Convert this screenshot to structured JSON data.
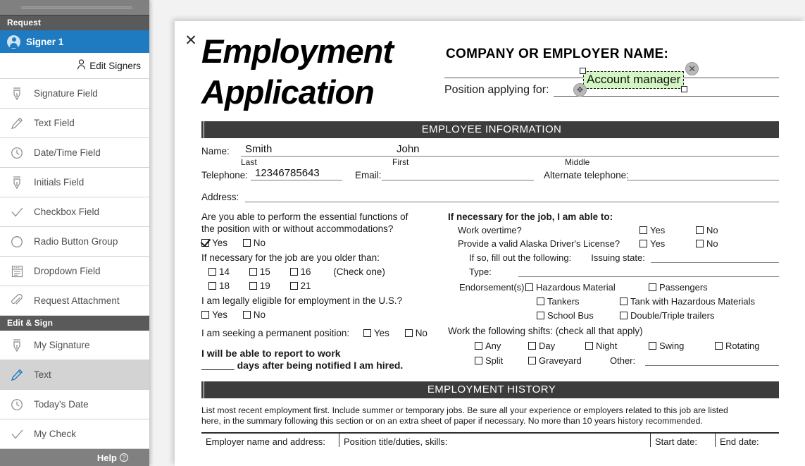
{
  "sidebar": {
    "request_header": "Request",
    "signer": {
      "label": "Signer 1",
      "icon": "person-circle-icon"
    },
    "edit_signers": {
      "label": "Edit Signers",
      "icon": "person-icon"
    },
    "request_items": [
      {
        "label": "Signature Field",
        "icon": "fountain-pen-icon"
      },
      {
        "label": "Text Field",
        "icon": "pencil-icon"
      },
      {
        "label": "Date/Time Field",
        "icon": "clock-icon"
      },
      {
        "label": "Initials Field",
        "icon": "fountain-pen-icon"
      },
      {
        "label": "Checkbox Field",
        "icon": "checkmark-icon"
      },
      {
        "label": "Radio Button Group",
        "icon": "circle-icon"
      },
      {
        "label": "Dropdown Field",
        "icon": "dropdown-list-icon"
      },
      {
        "label": "Request Attachment",
        "icon": "paperclip-icon"
      }
    ],
    "edit_sign_header": "Edit & Sign",
    "edit_sign_items": [
      {
        "label": "My Signature",
        "icon": "fountain-pen-icon",
        "selected": false
      },
      {
        "label": "Text",
        "icon": "pencil-icon",
        "selected": true
      },
      {
        "label": "Today's Date",
        "icon": "clock-icon",
        "selected": false
      },
      {
        "label": "My Check",
        "icon": "checkmark-icon",
        "selected": false
      }
    ],
    "help": {
      "label": "Help",
      "icon": "question-circle-icon"
    },
    "accent_color": "#1f7bc1",
    "header_color": "#5a5a5a",
    "selected_row_color": "#d3d3d3"
  },
  "document": {
    "close_icon": "close-icon",
    "title_line1": "Employment",
    "title_line2": "Application",
    "company_label": "COMPANY OR EMPLOYER NAME:",
    "position_label": "Position applying for:",
    "selected_field": {
      "value": "Account manager",
      "highlight_color": "#d4f5c4",
      "close_icon": "close-icon",
      "move_icon": "move-handle-icon"
    },
    "section_employee": "EMPLOYEE INFORMATION",
    "employee": {
      "name_label": "Name:",
      "last_value": "Smith",
      "first_value": "John",
      "middle_value": "",
      "last_sub": "Last",
      "first_sub": "First",
      "middle_sub": "Middle",
      "telephone_label": "Telephone:",
      "telephone_value": "12346785643",
      "email_label": "Email:",
      "email_value": "",
      "alt_telephone_label": "Alternate telephone:",
      "alt_telephone_value": "",
      "address_label": "Address:",
      "address_value": ""
    },
    "q_essential": {
      "text_line1": "Are you able to perform the essential functions of",
      "text_line2": "the position with or without accommodations?",
      "yes": "Yes",
      "no": "No",
      "yes_checked": true,
      "no_checked": false
    },
    "q_age": {
      "text": "If necessary for the job are you older than:",
      "row1": [
        "14",
        "15",
        "16"
      ],
      "row2": [
        "18",
        "19",
        "21"
      ],
      "note": "(Check one)"
    },
    "q_eligible": {
      "text": "I am legally eligible for employment in the U.S.?",
      "yes": "Yes",
      "no": "No"
    },
    "q_permanent": {
      "text": "I am seeking a permanent position:",
      "yes": "Yes",
      "no": "No"
    },
    "q_report": {
      "line1": "I will be able to report to work",
      "blank": "______",
      "line2": "days after being notified I am hired."
    },
    "q_able": {
      "heading": "If necessary for the job, I am able to:",
      "overtime_label": "Work overtime?",
      "license_label": "Provide a valid Alaska Driver's License?",
      "yes": "Yes",
      "no": "No",
      "if_so_label": "If so, fill out the following:",
      "issuing_state_label": "Issuing state:",
      "issuing_state_value": "",
      "type_label": "Type:",
      "type_value": "",
      "endorsements_label": "Endorsement(s):",
      "endorsements": [
        [
          "Hazardous Material",
          "Passengers"
        ],
        [
          "Tankers",
          "Tank with Hazardous Materials"
        ],
        [
          "School Bus",
          "Double/Triple trailers"
        ]
      ]
    },
    "q_shifts": {
      "heading": "Work the following shifts: (check all that apply)",
      "row1": [
        "Any",
        "Day",
        "Night",
        "Swing",
        "Rotating"
      ],
      "row2": [
        "Split",
        "Graveyard"
      ],
      "other_label": "Other:",
      "other_value": ""
    },
    "section_history": "EMPLOYMENT HISTORY",
    "history_note_line1": "List most recent employment first. Include summer or temporary jobs. Be sure all your experience or employers related to this job are listed",
    "history_note_line2": "here, in the summary following this section or on an extra sheet of paper if necessary. No more than 10 years history recommended.",
    "history_columns": [
      "Employer name and address:",
      "Position title/duties, skills:",
      "Start date:",
      "End date:"
    ]
  }
}
